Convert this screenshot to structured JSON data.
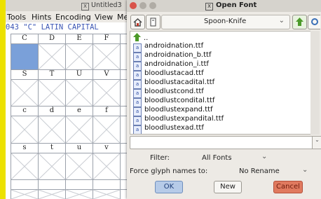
{
  "background_window": {
    "title": "Untitled3",
    "menu": [
      "Tools",
      "Hints",
      "Encoding",
      "View",
      "Me"
    ],
    "status": "043 \"C\" LATIN CAPITAL",
    "grid_rows": [
      [
        "C",
        "D",
        "E",
        "F"
      ],
      [
        "S",
        "T",
        "U",
        "V"
      ],
      [
        "c",
        "d",
        "e",
        "f"
      ],
      [
        "s",
        "t",
        "u",
        "v"
      ]
    ]
  },
  "dialog": {
    "title": "Open Font",
    "directory": "Spoon-Knife",
    "files": [
      "..",
      "androidnation.ttf",
      "androidnation_b.ttf",
      "androidnation_i.ttf",
      "bloodlustacad.ttf",
      "bloodlustacadital.ttf",
      "bloodlustcond.ttf",
      "bloodlustcondital.ttf",
      "bloodlustexpand.ttf",
      "bloodlustexpandital.ttf",
      "bloodlustexad.ttf"
    ],
    "filename_value": "",
    "filter_label": "Filter:",
    "filter_value": "All Fonts",
    "force_label": "Force glyph names to:",
    "force_value": "No Rename",
    "ok_label": "OK",
    "new_label": "New",
    "cancel_label": "Cancel"
  },
  "colors": {
    "selected_cell": "#7aa0d9",
    "status_text": "#3b55b4",
    "ok_button": "#b6cbe8",
    "cancel_button": "#e07a5f",
    "green_arrow": "#4c9a2a"
  }
}
